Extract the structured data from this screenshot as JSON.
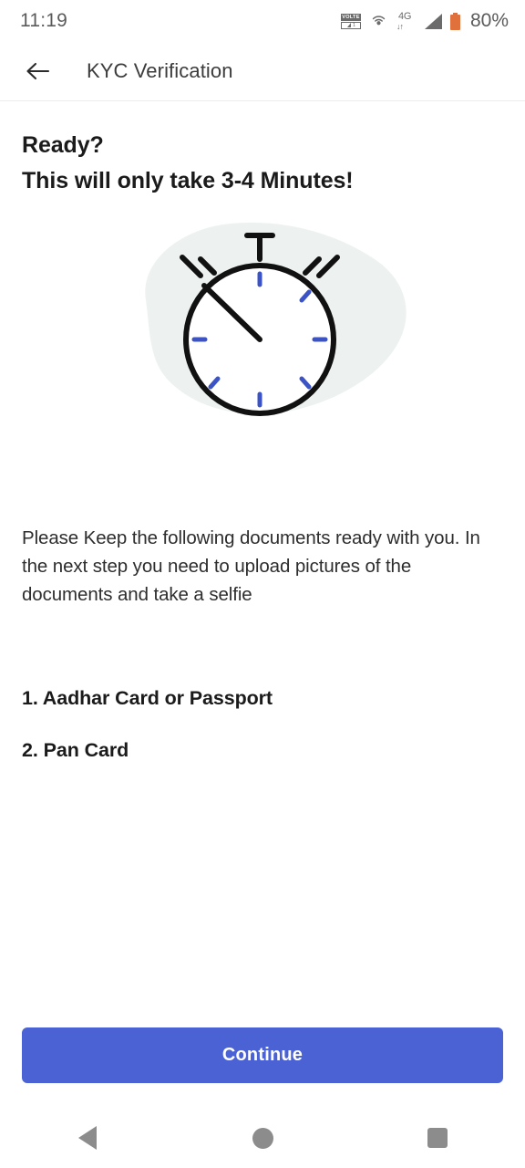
{
  "status_bar": {
    "time": "11:19",
    "battery_percent": "80%",
    "volte_label": "VOLTE",
    "volte_sim": "1",
    "network_type": "4G",
    "network_arrows": "↓↑",
    "icons": [
      "volte-icon",
      "hotspot-icon",
      "network-4g-icon",
      "signal-bars-icon",
      "battery-icon"
    ],
    "battery_color": "#e0703c",
    "text_color": "#5b5b5b"
  },
  "app_bar": {
    "back_label": "back-arrow",
    "title": "KYC Verification"
  },
  "heading": {
    "line1": "Ready?",
    "line2": "This will only take 3-4 Minutes!"
  },
  "illustration": {
    "name": "stopwatch-illustration",
    "blob_color": "#edf2f1",
    "outline_color": "#111111",
    "tick_color": "#3b53c4",
    "dial_color": "#ffffff"
  },
  "body": {
    "paragraph": "Please Keep the following documents ready with you. In the next step you need to upload pictures of the documents and take a selfie"
  },
  "documents": [
    {
      "label": "1. Aadhar Card or Passport"
    },
    {
      "label": "2. Pan Card"
    }
  ],
  "cta": {
    "label": "Continue",
    "background": "#4a62d4",
    "text_color": "#ffffff"
  },
  "nav_bar": {
    "back": "back-triangle-icon",
    "home": "home-circle-icon",
    "recents": "recents-square-icon",
    "color": "#8c8c8c"
  }
}
